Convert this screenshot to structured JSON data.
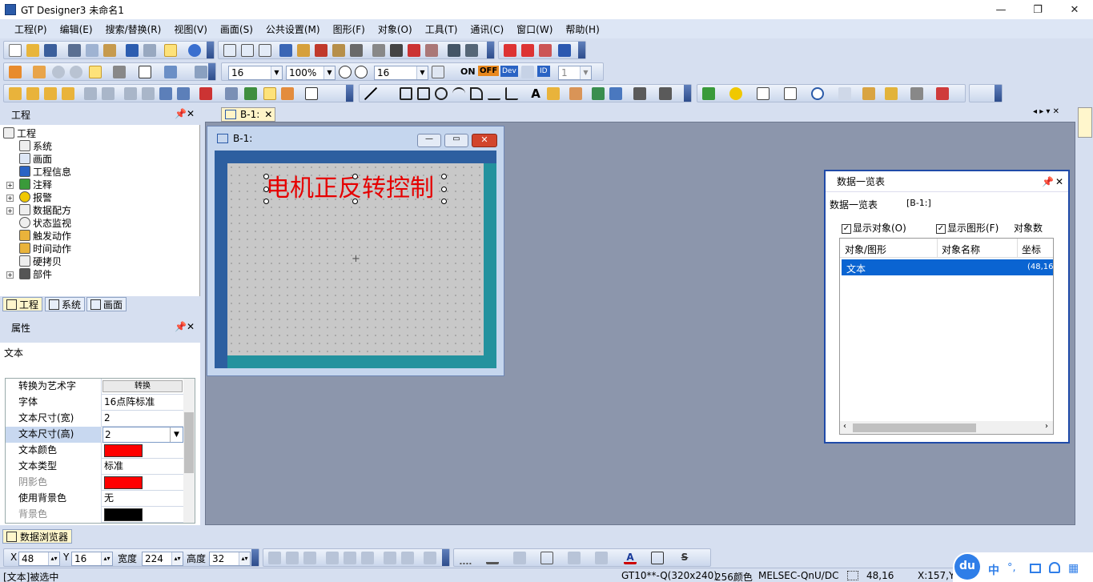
{
  "window": {
    "title": "GT Designer3 未命名1",
    "minimize": "—",
    "maximize": "❐",
    "close": "✕"
  },
  "menu": [
    "工程(P)",
    "编辑(E)",
    "搜索/替换(R)",
    "视图(V)",
    "画面(S)",
    "公共设置(M)",
    "图形(F)",
    "对象(O)",
    "工具(T)",
    "通讯(C)",
    "窗口(W)",
    "帮助(H)"
  ],
  "toolbar": {
    "font_size": "16",
    "zoom": "100%",
    "grid": "16",
    "on_label": "ON",
    "off_label": "OFF",
    "dev_label": "Dev",
    "id_label": "ID",
    "station": "1"
  },
  "project_panel": {
    "title": "工程",
    "root": "工程",
    "items": [
      "系统",
      "画面",
      "工程信息",
      "注释",
      "报警",
      "数据配方",
      "状态监视",
      "触发动作",
      "时间动作",
      "硬拷贝",
      "部件"
    ],
    "tabs": [
      "工程",
      "系统",
      "画面"
    ]
  },
  "props_panel": {
    "title": "属性",
    "object": "文本",
    "rows": [
      {
        "name": "转换为艺术字",
        "value": "转换"
      },
      {
        "name": "字体",
        "value": "16点阵标准"
      },
      {
        "name": "文本尺寸(宽)",
        "value": "2"
      },
      {
        "name": "文本尺寸(高)",
        "value": "2"
      },
      {
        "name": "文本颜色",
        "value": ""
      },
      {
        "name": "文本类型",
        "value": "标准"
      },
      {
        "name": "阴影色",
        "value": ""
      },
      {
        "name": "使用背景色",
        "value": "无"
      },
      {
        "name": "背景色",
        "value": ""
      }
    ],
    "text_color": "#ff0000",
    "shadow_color": "#ff0000",
    "bg_color": "#000000"
  },
  "data_browser_tab": "数据浏览器",
  "doc_tab": "B-1:",
  "screen_window": {
    "title": "B-1:",
    "text": "电机正反转控制",
    "text_color": "#e60000"
  },
  "data_list": {
    "title": "数据一览表",
    "subtitle": "数据一览表",
    "screen_ref": "[B-1:]",
    "show_objects": "显示对象(O)",
    "show_figures": "显示图形(F)",
    "object_count": "对象数",
    "columns": [
      "对象/图形",
      "对象名称",
      "坐标"
    ],
    "rows": [
      {
        "type": "文本",
        "name": "",
        "coord": "(48,16"
      }
    ]
  },
  "bottom_toolbar": {
    "x_label": "X",
    "x": "48",
    "y_label": "Y",
    "y": "16",
    "w_label": "宽度",
    "w": "224",
    "h_label": "高度",
    "h": "32"
  },
  "status": {
    "selection": "[文本]被选中",
    "model": "GT10**-Q(320x240)",
    "colors": "256颜色",
    "plc": "MELSEC-QnU/DC",
    "pos": "48,16",
    "cursor": "X:157,Y:"
  },
  "ime": {
    "logo": "du",
    "lang": "中"
  },
  "colors": {
    "accent": "#0a64d2",
    "selected_row": "#0a64d2"
  }
}
